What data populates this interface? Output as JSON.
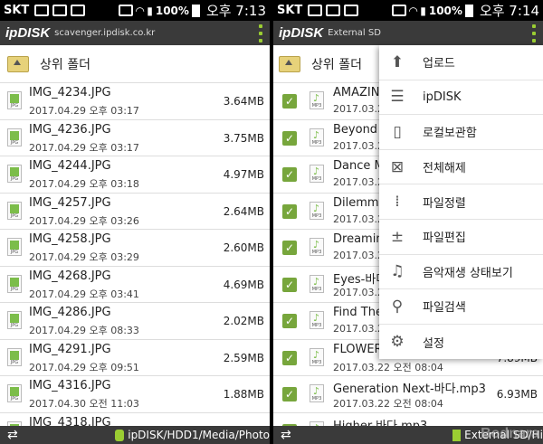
{
  "status_left": {
    "carrier": "SKT",
    "battery": "100%",
    "time": "오후 7:13"
  },
  "status_right": {
    "carrier": "SKT",
    "battery": "100%",
    "time": "오후 7:14"
  },
  "left_panel": {
    "app_logo": "ipDISK",
    "host": "scavenger.ipdisk.co.kr",
    "parent_folder": "상위 폴더",
    "files": [
      {
        "name": "IMG_4234.JPG",
        "date": "2017.04.29 오후 03:17",
        "size": "3.64MB"
      },
      {
        "name": "IMG_4236.JPG",
        "date": "2017.04.29 오후 03:17",
        "size": "3.75MB"
      },
      {
        "name": "IMG_4244.JPG",
        "date": "2017.04.29 오후 03:18",
        "size": "4.97MB"
      },
      {
        "name": "IMG_4257.JPG",
        "date": "2017.04.29 오후 03:26",
        "size": "2.64MB"
      },
      {
        "name": "IMG_4258.JPG",
        "date": "2017.04.29 오후 03:29",
        "size": "2.60MB"
      },
      {
        "name": "IMG_4268.JPG",
        "date": "2017.04.29 오후 03:41",
        "size": "4.69MB"
      },
      {
        "name": "IMG_4286.JPG",
        "date": "2017.04.29 오후 08:33",
        "size": "2.02MB"
      },
      {
        "name": "IMG_4291.JPG",
        "date": "2017.04.29 오후 09:51",
        "size": "2.59MB"
      },
      {
        "name": "IMG_4316.JPG",
        "date": "2017.04.30 오전 11:03",
        "size": "1.88MB"
      },
      {
        "name": "IMG_4318.JPG",
        "date": "",
        "size": ""
      }
    ],
    "path": "ipDISK/HDD1/Media/Photo"
  },
  "right_panel": {
    "app_logo": "ipDISK",
    "host": "External SD",
    "parent_folder": "상위 폴더",
    "files": [
      {
        "name": "AMAZIN",
        "date": "2017.03.2",
        "size": ""
      },
      {
        "name": "Beyond (",
        "date": "2017.03.2",
        "size": ""
      },
      {
        "name": "Dance M",
        "date": "2017.03.2",
        "size": ""
      },
      {
        "name": "Dilemma",
        "date": "2017.03.2",
        "size": ""
      },
      {
        "name": "Dreamin",
        "date": "2017.03.2",
        "size": ""
      },
      {
        "name": "Eyes-바다",
        "date": "2017.03.2",
        "size": ""
      },
      {
        "name": "Find The",
        "date": "2017.03.2",
        "size": ""
      },
      {
        "name": "FLOWER",
        "date": "2017.03.22 오전 08:04",
        "size": "7.89MB"
      },
      {
        "name": "Generation Next-바다.mp3",
        "date": "2017.03.22 오전 08:04",
        "size": "6.93MB"
      },
      {
        "name": "Higher-바다.mp3",
        "date": "",
        "size": ""
      }
    ],
    "path": "External SD/Hi",
    "watermark": "Bodnara"
  },
  "menu": {
    "items": [
      {
        "label": "업로드",
        "icon": "upload-icon",
        "glyph": "⬆"
      },
      {
        "label": "ipDISK",
        "icon": "server-icon",
        "glyph": "☰"
      },
      {
        "label": "로컬보관함",
        "icon": "phone-icon",
        "glyph": "▯"
      },
      {
        "label": "전체해제",
        "icon": "deselect-all-icon",
        "glyph": "⊠"
      },
      {
        "label": "파일정렬",
        "icon": "sort-icon",
        "glyph": "⁞"
      },
      {
        "label": "파일편집",
        "icon": "edit-icon",
        "glyph": "±"
      },
      {
        "label": "음악재생 상태보기",
        "icon": "music-icon",
        "glyph": "♫"
      },
      {
        "label": "파일검색",
        "icon": "search-icon",
        "glyph": "⚲"
      },
      {
        "label": "설정",
        "icon": "settings-icon",
        "glyph": "⚙"
      }
    ]
  },
  "colors": {
    "accent": "#9acd32",
    "appbar": "#3a3a3a",
    "checkbox": "#77a63c"
  }
}
